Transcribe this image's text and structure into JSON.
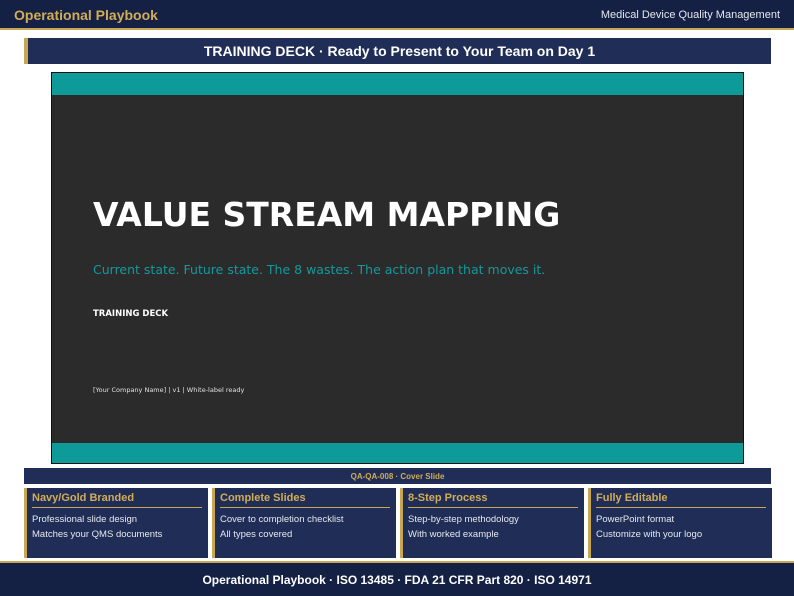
{
  "header": {
    "brand": "Operational Playbook",
    "subtitle": "Medical Device Quality Management"
  },
  "banner": {
    "text": "TRAINING DECK  ·  Ready to Present to Your Team on Day 1"
  },
  "slide": {
    "title": "VALUE STREAM MAPPING",
    "subtitle": "Current state. Future state. The 8 wastes. The action plan that moves it.",
    "label": "TRAINING DECK",
    "footer": "[Your Company Name]    |    v1    |    White-label ready"
  },
  "caption": {
    "text": "QA-QA-008  ·  Cover Slide"
  },
  "features": [
    {
      "title": "Navy/Gold Branded",
      "lines": [
        "Professional slide design",
        "Matches your QMS documents"
      ]
    },
    {
      "title": "Complete Slides",
      "lines": [
        "Cover to completion checklist",
        "All types covered"
      ]
    },
    {
      "title": "8-Step Process",
      "lines": [
        "Step-by-step methodology",
        "With worked example"
      ]
    },
    {
      "title": "Fully Editable",
      "lines": [
        "PowerPoint format",
        "Customize with your logo"
      ]
    }
  ],
  "footer": {
    "text": "Operational Playbook  ·  ISO 13485  ·  FDA 21 CFR Part 820  ·  ISO 14971"
  },
  "colors": {
    "navy": "#142044",
    "navy_panel": "#1f2d57",
    "gold": "#c8a653",
    "teal": "#0f9a9a",
    "slide_bg": "#2b2b2b"
  }
}
